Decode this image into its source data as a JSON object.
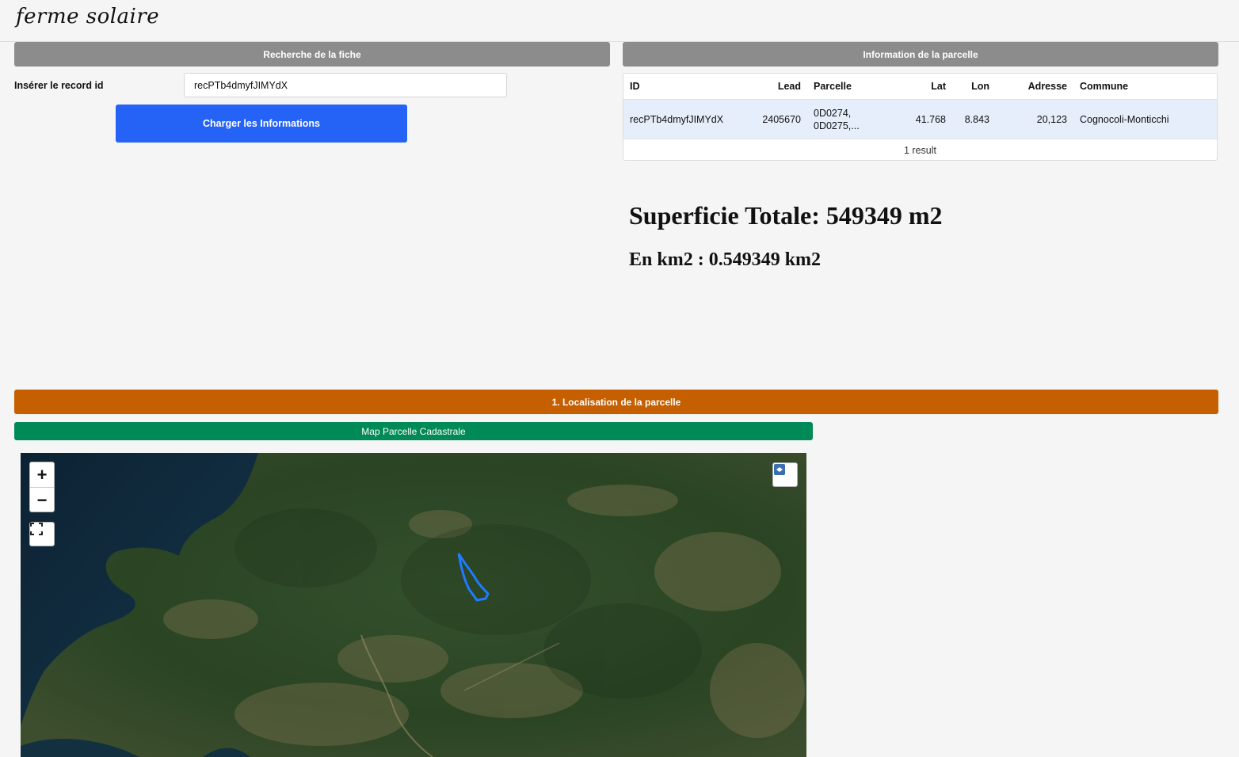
{
  "app": {
    "logo": "ferme solaire"
  },
  "search": {
    "header": "Recherche de la fiche",
    "record_label": "Insérer le record id",
    "record_value": "recPTb4dmyfJIMYdX",
    "load_button": "Charger les Informations"
  },
  "parcel_info": {
    "header": "Information de la parcelle",
    "columns": [
      "ID",
      "Lead",
      "Parcelle",
      "Lat",
      "Lon",
      "Adresse",
      "Commune"
    ],
    "rows": [
      {
        "id": "recPTb4dmyfJIMYdX",
        "lead": "2405670",
        "parcelle_1": "0D0274,",
        "parcelle_2": "0D0275,...",
        "lat": "41.768",
        "lon": "8.843",
        "adresse": "20,123",
        "commune": "Cognocoli-Monticchi"
      }
    ],
    "result_count": "1 result"
  },
  "area": {
    "total": "Superficie Totale: 549349 m2",
    "km2": "En km2 : 0.549349 km2"
  },
  "localisation": {
    "header": "1. Localisation de la parcelle",
    "map_tab": "Map Parcelle Cadastrale"
  },
  "map": {
    "zoom_in": "+",
    "zoom_out": "−",
    "fullscreen_icon": "fullscreen-icon",
    "layers_icon": "layers-icon",
    "parcel_color": "#1f7bff"
  }
}
